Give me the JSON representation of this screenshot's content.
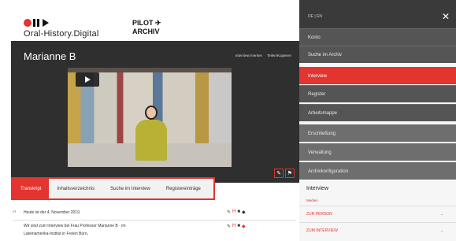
{
  "header": {
    "logo_text": "Oral-History.Digital",
    "pilot_line1": "PILOT ✈",
    "pilot_line2": "ARCHIV"
  },
  "interview": {
    "title": "Marianne B",
    "action_1": "Interview merken",
    "action_2": "Teilen/Kopieren"
  },
  "tabs": [
    {
      "label": "Transkript",
      "active": true
    },
    {
      "label": "Inhaltsverzeichnis",
      "active": false
    },
    {
      "label": "Suche im Interview",
      "active": false
    },
    {
      "label": "Registereinträge",
      "active": false
    }
  ],
  "transcript": [
    {
      "text": "Heute ist der 4. November 2019."
    },
    {
      "text": "Wir sind zum Interview bei Frau Professor Marianne B · im"
    },
    {
      "text": "Lateinamerika-Institut in Freien Büro,"
    }
  ],
  "menu": {
    "lang": "DE | EN",
    "items": [
      {
        "label": "Konto"
      },
      {
        "label": "Suche im Archiv"
      },
      {
        "label": "Interview"
      },
      {
        "label": "Register"
      },
      {
        "label": "Arbeitsmappe"
      },
      {
        "label": "Erschließung"
      },
      {
        "label": "Verwaltung"
      },
      {
        "label": "Archivkonfiguration"
      }
    ],
    "section_title": "Interview",
    "section_link": "Medien",
    "sub_items": [
      {
        "label": "ZUR PERSON"
      },
      {
        "label": "ZUM INTERVIEW"
      }
    ]
  },
  "colors": {
    "accent": "#e3342f",
    "menu_dark": "#555555",
    "stage": "#2f2f2f"
  }
}
